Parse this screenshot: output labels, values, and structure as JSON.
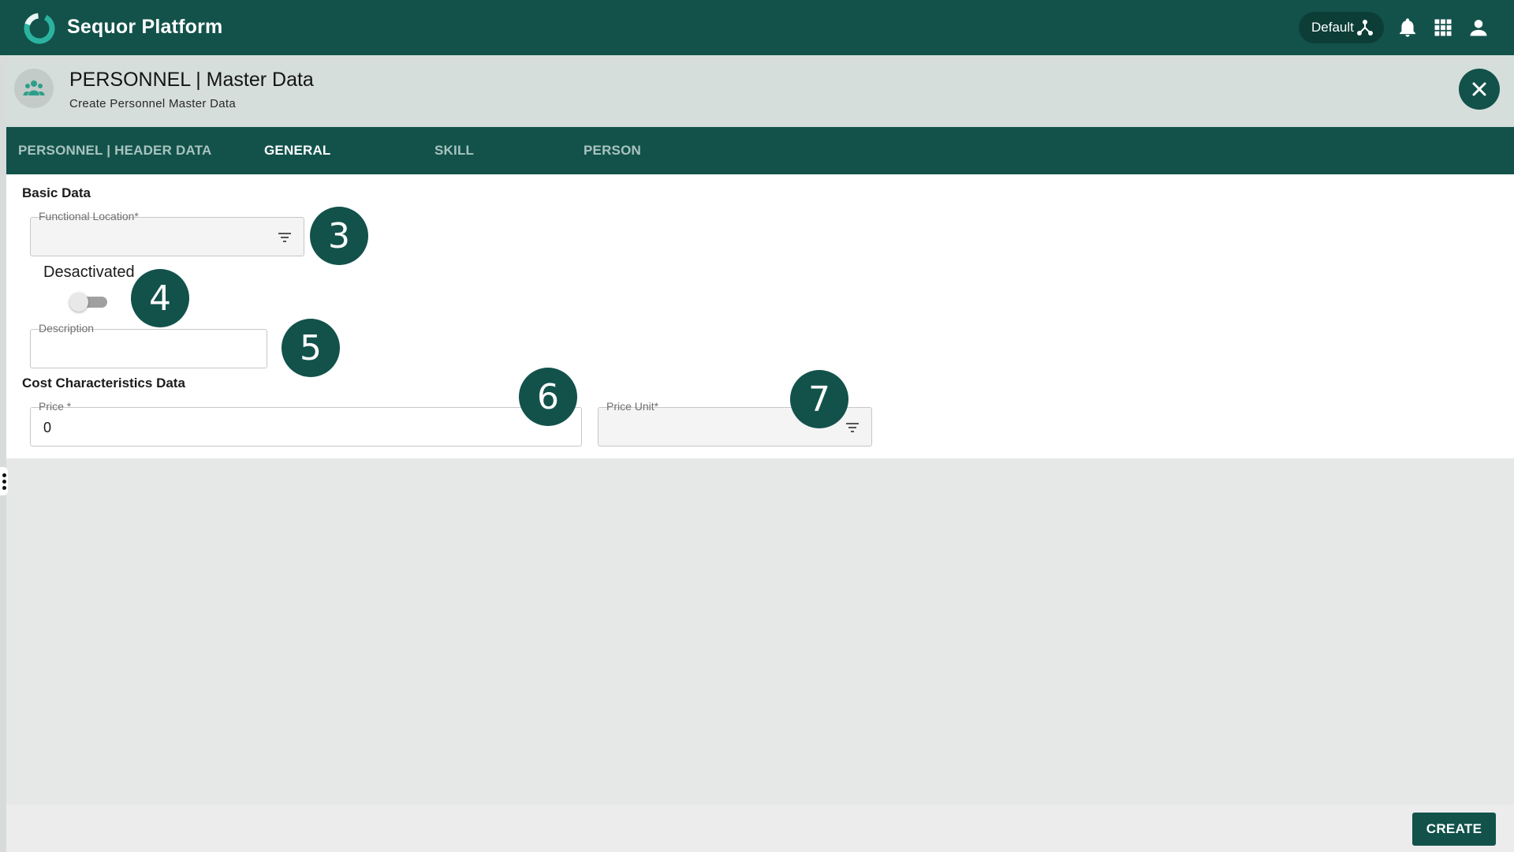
{
  "app": {
    "title": "Sequor Platform",
    "environment": "Default",
    "icons": [
      "logo-ring-icon",
      "share-network-icon",
      "bell-icon",
      "apps-grid-icon",
      "user-icon"
    ]
  },
  "header": {
    "title": "PERSONNEL | Master Data",
    "subtitle": "Create Personnel Master Data",
    "avatar_icon": "people-group-icon",
    "close_icon": "close-icon"
  },
  "tabs": [
    {
      "label": "PERSONNEL | HEADER DATA",
      "active": false
    },
    {
      "label": "GENERAL",
      "active": true
    },
    {
      "label": "SKILL",
      "active": false
    },
    {
      "label": "PERSON",
      "active": false
    }
  ],
  "basic_data": {
    "title": "Basic Data",
    "functional_location": {
      "label": "Functional Location*",
      "value": ""
    },
    "deactivated": {
      "label": "Desactivated",
      "checked": false
    },
    "description": {
      "label": "Description",
      "value": ""
    }
  },
  "cost_data": {
    "title": "Cost Characteristics Data",
    "price": {
      "label": "Price *",
      "value": "0"
    },
    "price_unit": {
      "label": "Price Unit*",
      "value": ""
    }
  },
  "callouts": [
    "3",
    "4",
    "5",
    "6",
    "7"
  ],
  "footer": {
    "create_label": "CREATE"
  },
  "colors": {
    "primary": "#12524b",
    "header_bg": "#d5dedb",
    "tab_inactive": "#a9c3bf"
  }
}
